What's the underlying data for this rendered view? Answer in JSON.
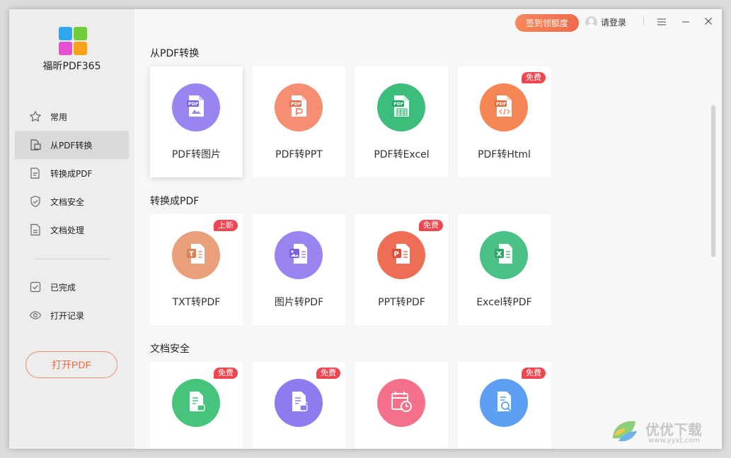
{
  "app": {
    "name": "福昕PDF365"
  },
  "topbar": {
    "signin_label": "签到领额度",
    "login_label": "请登录"
  },
  "sidebar": {
    "items": [
      {
        "label": "常用",
        "icon": "star-icon"
      },
      {
        "label": "从PDF转换",
        "icon": "document-convert-icon"
      },
      {
        "label": "转换成PDF",
        "icon": "document-export-icon"
      },
      {
        "label": "文档安全",
        "icon": "shield-icon"
      },
      {
        "label": "文档处理",
        "icon": "document-edit-icon"
      }
    ],
    "secondary_items": [
      {
        "label": "已完成",
        "icon": "check-box-icon"
      },
      {
        "label": "打开记录",
        "icon": "eye-icon"
      }
    ],
    "open_button_label": "打开PDF"
  },
  "sections": [
    {
      "title": "从PDF转换",
      "cards": [
        {
          "label": "PDF转图片",
          "badge": "",
          "color": "#9b84ef",
          "icon": "pdf-image-icon"
        },
        {
          "label": "PDF转PPT",
          "badge": "",
          "color": "#f58e73",
          "icon": "pdf-ppt-icon"
        },
        {
          "label": "PDF转Excel",
          "badge": "",
          "color": "#3dbd7b",
          "icon": "pdf-excel-icon"
        },
        {
          "label": "PDF转Html",
          "badge": "免费",
          "color": "#f68656",
          "icon": "pdf-html-icon"
        }
      ]
    },
    {
      "title": "转换成PDF",
      "cards": [
        {
          "label": "TXT转PDF",
          "badge": "上新",
          "color": "#e9a07a",
          "icon": "txt-pdf-icon"
        },
        {
          "label": "图片转PDF",
          "badge": "",
          "color": "#9b84ef",
          "icon": "image-pdf-icon"
        },
        {
          "label": "PPT转PDF",
          "badge": "免费",
          "color": "#ee6e55",
          "icon": "ppt-pdf-icon"
        },
        {
          "label": "Excel转PDF",
          "badge": "",
          "color": "#4cc186",
          "icon": "excel-pdf-icon"
        }
      ]
    },
    {
      "title": "文档安全",
      "cards": [
        {
          "label": "",
          "badge": "免费",
          "color": "#46c47c",
          "icon": "document-lock-icon"
        },
        {
          "label": "",
          "badge": "免费",
          "color": "#8c7cf0",
          "icon": "document-unlock-icon"
        },
        {
          "label": "",
          "badge": "",
          "color": "#f5708a",
          "icon": "calendar-clock-icon"
        },
        {
          "label": "",
          "badge": "免费",
          "color": "#5d9ff2",
          "icon": "document-search-icon"
        }
      ]
    }
  ],
  "watermark": {
    "brand": "优优下载",
    "url": "www.yyxt.com"
  }
}
